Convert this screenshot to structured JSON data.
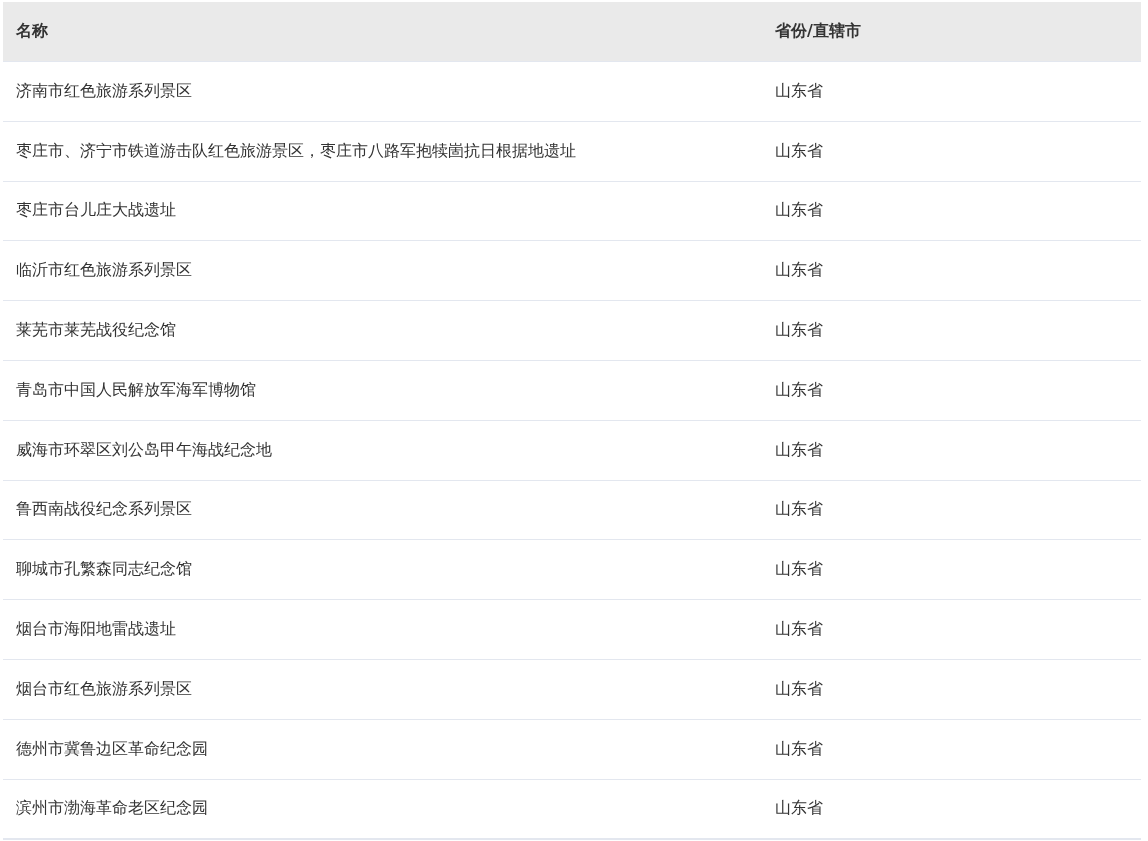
{
  "table": {
    "columns": [
      "名称",
      "省份/直辖市"
    ],
    "rows": [
      [
        "济南市红色旅游系列景区",
        "山东省"
      ],
      [
        "枣庄市、济宁市铁道游击队红色旅游景区，枣庄市八路军抱犊崮抗日根据地遗址",
        "山东省"
      ],
      [
        "枣庄市台儿庄大战遗址",
        "山东省"
      ],
      [
        "临沂市红色旅游系列景区",
        "山东省"
      ],
      [
        "莱芜市莱芜战役纪念馆",
        "山东省"
      ],
      [
        "青岛市中国人民解放军海军博物馆",
        "山东省"
      ],
      [
        "威海市环翠区刘公岛甲午海战纪念地",
        "山东省"
      ],
      [
        "鲁西南战役纪念系列景区",
        "山东省"
      ],
      [
        "聊城市孔繁森同志纪念馆",
        "山东省"
      ],
      [
        "烟台市海阳地雷战遗址",
        "山东省"
      ],
      [
        "烟台市红色旅游系列景区",
        "山东省"
      ],
      [
        "德州市冀鲁边区革命纪念园",
        "山东省"
      ],
      [
        "滨州市渤海革命老区纪念园",
        "山东省"
      ]
    ]
  }
}
